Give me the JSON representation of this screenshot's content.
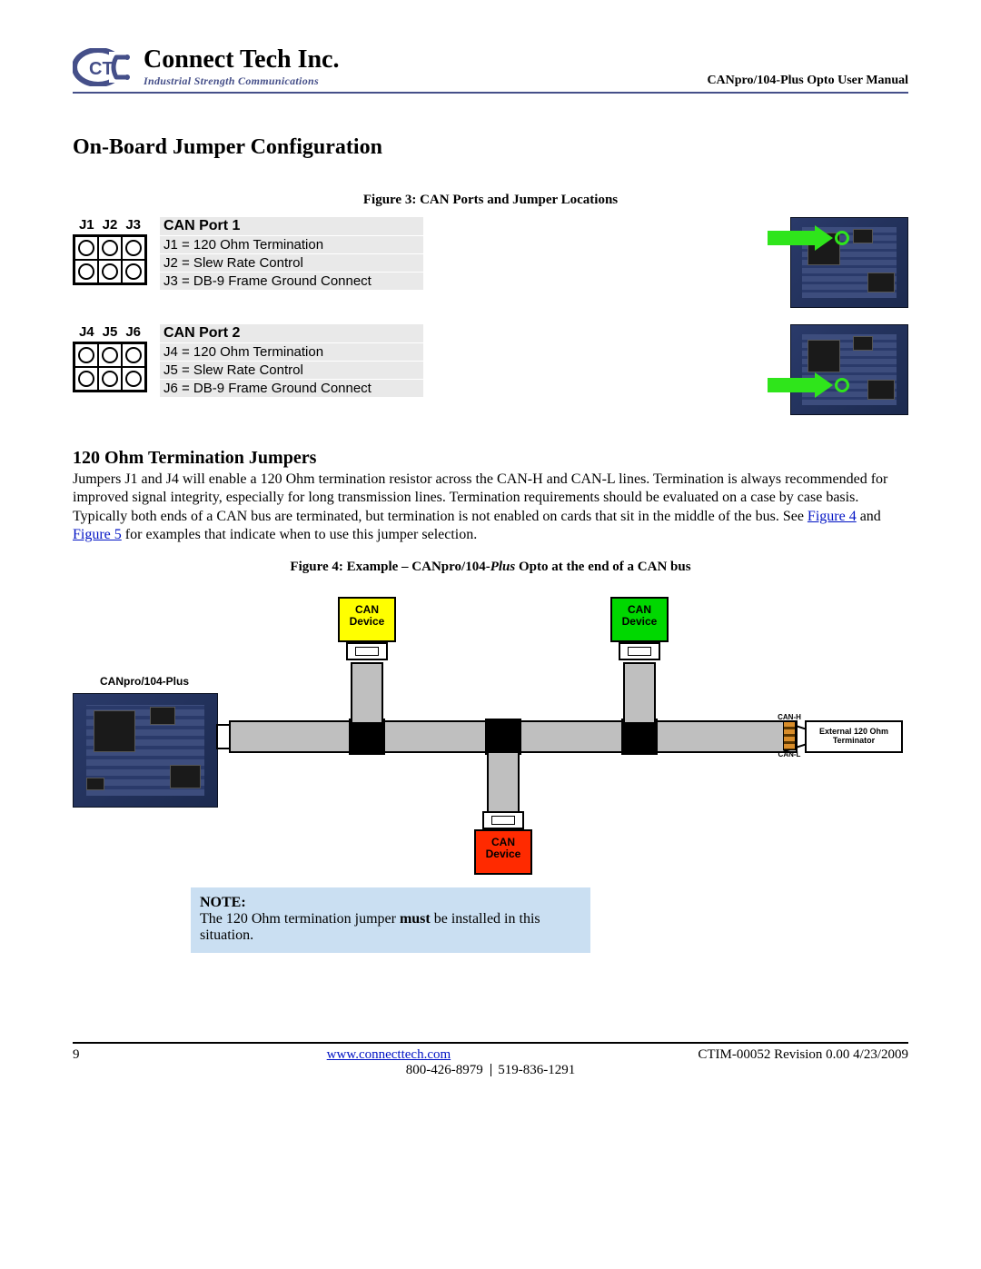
{
  "header": {
    "brand_name": "Connect Tech Inc.",
    "brand_tag": "Industrial Strength Communications",
    "doc_title": "CANpro/104-Plus Opto User Manual"
  },
  "section_title": "On-Board Jumper Configuration",
  "figure3": {
    "caption": "Figure 3: CAN Ports and Jumper Locations",
    "port1": {
      "jumper_labels": [
        "J1",
        "J2",
        "J3"
      ],
      "title": "CAN Port 1",
      "lines": [
        "J1 = 120 Ohm Termination",
        "J2 = Slew Rate Control",
        "J3 = DB-9 Frame Ground Connect"
      ]
    },
    "port2": {
      "jumper_labels": [
        "J4",
        "J5",
        "J6"
      ],
      "title": "CAN Port 2",
      "lines": [
        "J4 = 120 Ohm Termination",
        "J5 = Slew Rate Control",
        "J6 = DB-9 Frame Ground Connect"
      ]
    }
  },
  "termination": {
    "heading": "120 Ohm Termination Jumpers",
    "body_pre": "Jumpers J1 and J4 will enable a 120 Ohm termination resistor across the CAN-H and CAN-L lines. Termination is always recommended for improved signal integrity, especially for long transmission lines. Termination requirements should be evaluated on a case by case basis. Typically both ends of a CAN bus are terminated, but termination is not enabled on cards that sit in the middle of the bus. See ",
    "link4": "Figure 4",
    "mid": " and ",
    "link5": "Figure 5",
    "body_post": " for examples that indicate when to use this jumper selection."
  },
  "figure4": {
    "caption_pre": "Figure 4: Example – CANpro/104-",
    "caption_ital": "Plus",
    "caption_post": " Opto at the end of a CAN bus",
    "board_label": "CANpro/104-Plus",
    "dev_label_line1": "CAN",
    "dev_label_line2": "Device",
    "ext_term": "External 120 Ohm Terminator",
    "canh": "CAN-H",
    "canl": "CAN-L"
  },
  "note": {
    "hdr": "NOTE:",
    "pre": "The 120 Ohm termination jumper ",
    "must": "must",
    "post": " be installed in this situation."
  },
  "footer": {
    "page": "9",
    "url": "www.connecttech.com",
    "rev": "CTIM-00052 Revision 0.00 4/23/2009",
    "phone1": "800-426-8979",
    "phone2": "519-836-1291"
  }
}
